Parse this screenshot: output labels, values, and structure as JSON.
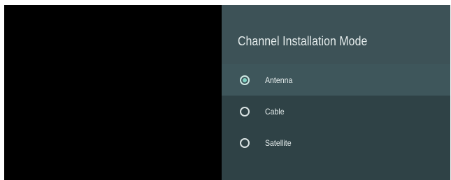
{
  "panel": {
    "title": "Channel Installation Mode",
    "options": [
      {
        "label": "Antenna",
        "selected": true,
        "focused": true
      },
      {
        "label": "Cable",
        "selected": false,
        "focused": false
      },
      {
        "label": "Satellite",
        "selected": false,
        "focused": false
      }
    ]
  },
  "colors": {
    "panel_background": "#2f4246",
    "header_background": "#3d5257",
    "focused_row": "#3e565b",
    "accent": "#7fd1c2",
    "text": "#e6eded"
  }
}
